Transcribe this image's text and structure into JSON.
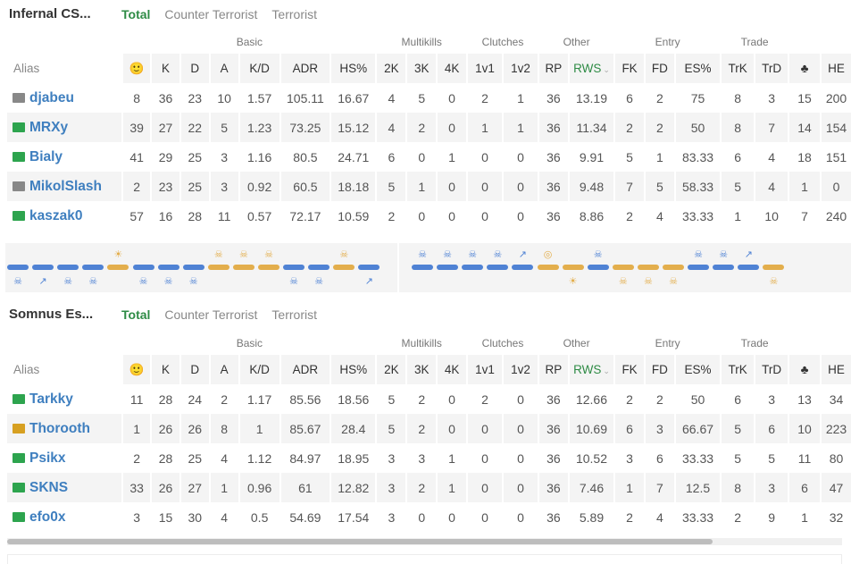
{
  "tabs": [
    "Total",
    "Counter Terrorist",
    "Terrorist"
  ],
  "groups": {
    "basic": "Basic",
    "multikills": "Multikills",
    "clutches": "Clutches",
    "other": "Other",
    "entry": "Entry",
    "trade": "Trade"
  },
  "columns": {
    "alias": "Alias",
    "smile": "🙂",
    "k": "K",
    "d": "D",
    "a": "A",
    "kd": "K/D",
    "adr": "ADR",
    "hs": "HS%",
    "k2": "2K",
    "k3": "3K",
    "k4": "4K",
    "c1": "1v1",
    "c2": "1v2",
    "rp": "RP",
    "rws": "RWS",
    "rws_sort": "⌄",
    "fk": "FK",
    "fd": "FD",
    "es": "ES%",
    "trk": "TrK",
    "trd": "TrD",
    "club": "♣",
    "he": "HE"
  },
  "teams": [
    {
      "name": "Infernal CS...",
      "players": [
        {
          "flag": "grey",
          "alias": "djabeu",
          "stats": [
            "8",
            "36",
            "23",
            "10",
            "1.57",
            "105.11",
            "16.67",
            "4",
            "5",
            "0",
            "2",
            "1",
            "36",
            "13.19",
            "6",
            "2",
            "75",
            "8",
            "3",
            "15",
            "200"
          ]
        },
        {
          "flag": "pl",
          "alias": "MRXy",
          "stats": [
            "39",
            "27",
            "22",
            "5",
            "1.23",
            "73.25",
            "15.12",
            "4",
            "2",
            "0",
            "1",
            "1",
            "36",
            "11.34",
            "2",
            "2",
            "50",
            "8",
            "7",
            "14",
            "154"
          ]
        },
        {
          "flag": "pl",
          "alias": "Bialy",
          "stats": [
            "41",
            "29",
            "25",
            "3",
            "1.16",
            "80.5",
            "24.71",
            "6",
            "0",
            "1",
            "0",
            "0",
            "36",
            "9.91",
            "5",
            "1",
            "83.33",
            "6",
            "4",
            "18",
            "151"
          ]
        },
        {
          "flag": "grey",
          "alias": "MikolSlash",
          "stats": [
            "2",
            "23",
            "25",
            "3",
            "0.92",
            "60.5",
            "18.18",
            "5",
            "1",
            "0",
            "0",
            "0",
            "36",
            "9.48",
            "7",
            "5",
            "58.33",
            "5",
            "4",
            "1",
            "0"
          ]
        },
        {
          "flag": "pl",
          "alias": "kaszak0",
          "stats": [
            "57",
            "16",
            "28",
            "11",
            "0.57",
            "72.17",
            "10.59",
            "2",
            "0",
            "0",
            "0",
            "0",
            "36",
            "8.86",
            "2",
            "4",
            "33.33",
            "1",
            "10",
            "7",
            "240"
          ]
        }
      ]
    },
    {
      "name": "Somnus Es...",
      "players": [
        {
          "flag": "pl",
          "alias": "Tarkky",
          "stats": [
            "11",
            "28",
            "24",
            "2",
            "1.17",
            "85.56",
            "18.56",
            "5",
            "2",
            "0",
            "2",
            "0",
            "36",
            "12.66",
            "2",
            "2",
            "50",
            "6",
            "3",
            "13",
            "34"
          ]
        },
        {
          "flag": "gold",
          "alias": "Thorooth",
          "stats": [
            "1",
            "26",
            "26",
            "8",
            "1",
            "85.67",
            "28.4",
            "5",
            "2",
            "0",
            "0",
            "0",
            "36",
            "10.69",
            "6",
            "3",
            "66.67",
            "5",
            "6",
            "10",
            "223"
          ]
        },
        {
          "flag": "pl",
          "alias": "Psikx",
          "stats": [
            "2",
            "28",
            "25",
            "4",
            "1.12",
            "84.97",
            "18.95",
            "3",
            "3",
            "1",
            "0",
            "0",
            "36",
            "10.52",
            "3",
            "6",
            "33.33",
            "5",
            "5",
            "11",
            "80"
          ]
        },
        {
          "flag": "pl",
          "alias": "SKNS",
          "stats": [
            "33",
            "26",
            "27",
            "1",
            "0.96",
            "61",
            "12.82",
            "3",
            "2",
            "1",
            "0",
            "0",
            "36",
            "7.46",
            "1",
            "7",
            "12.5",
            "8",
            "3",
            "6",
            "47"
          ]
        },
        {
          "flag": "pl",
          "alias": "efo0x",
          "stats": [
            "3",
            "15",
            "30",
            "4",
            "0.5",
            "54.69",
            "17.54",
            "3",
            "0",
            "0",
            "0",
            "0",
            "36",
            "5.89",
            "2",
            "4",
            "33.33",
            "2",
            "9",
            "1",
            "32"
          ]
        }
      ]
    }
  ],
  "timeline": {
    "rounds": [
      "ct",
      "ct",
      "ct",
      "ct",
      "t",
      "ct",
      "ct",
      "ct",
      "t",
      "t",
      "t",
      "ct",
      "ct",
      "t",
      "ct",
      "ct",
      "ct",
      "ct",
      "ct",
      "ct",
      "t",
      "t",
      "ct",
      "t",
      "t",
      "t",
      "ct",
      "ct",
      "ct",
      "t"
    ],
    "top_icons": [
      "",
      "",
      "",
      "",
      "sun",
      "",
      "",
      "",
      "skull",
      "skull",
      "skull",
      "",
      "",
      "skull",
      "",
      "skull",
      "skull",
      "skull",
      "skull",
      "defuse",
      "bomb",
      "",
      "skull",
      "",
      "",
      "",
      "skull",
      "skull",
      "defuse",
      ""
    ],
    "bottom_icons": [
      "skull",
      "defuse",
      "skull",
      "skull",
      "",
      "skull",
      "skull",
      "skull",
      "",
      "",
      "",
      "skull",
      "skull",
      "",
      "defuse",
      "",
      "",
      "",
      "",
      "",
      "",
      "sun",
      "",
      "skull",
      "skull",
      "skull",
      "",
      "",
      "",
      "skull"
    ],
    "colors": {
      "ct": "#4f82d4",
      "t": "#e3ae4c",
      "accent": "#2e8b45"
    }
  }
}
